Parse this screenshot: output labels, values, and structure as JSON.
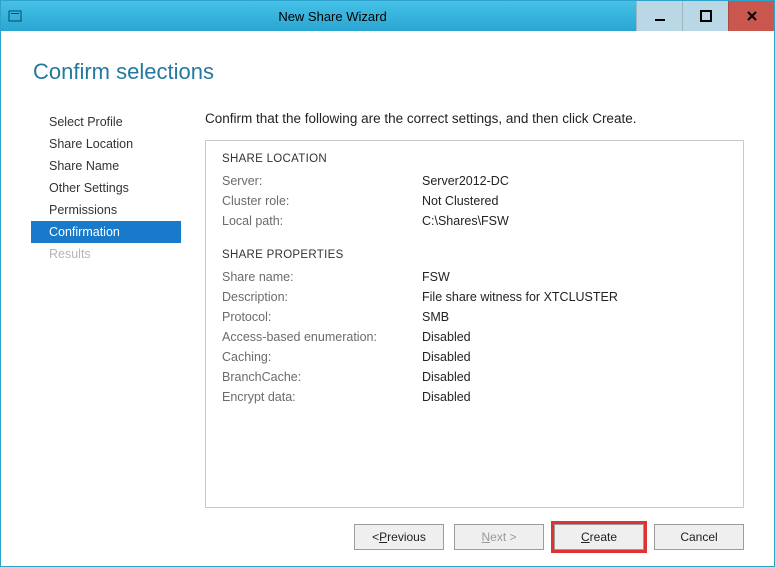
{
  "window": {
    "title": "New Share Wizard"
  },
  "heading": "Confirm selections",
  "sidebar": {
    "items": [
      {
        "label": "Select Profile"
      },
      {
        "label": "Share Location"
      },
      {
        "label": "Share Name"
      },
      {
        "label": "Other Settings"
      },
      {
        "label": "Permissions"
      },
      {
        "label": "Confirmation"
      },
      {
        "label": "Results"
      }
    ]
  },
  "main": {
    "instruction": "Confirm that the following are the correct settings, and then click Create.",
    "sections": {
      "location": {
        "title": "SHARE LOCATION",
        "server_lbl": "Server:",
        "server_val": "Server2012-DC",
        "cluster_lbl": "Cluster role:",
        "cluster_val": "Not Clustered",
        "path_lbl": "Local path:",
        "path_val": "C:\\Shares\\FSW"
      },
      "props": {
        "title": "SHARE PROPERTIES",
        "name_lbl": "Share name:",
        "name_val": "FSW",
        "desc_lbl": "Description:",
        "desc_val": "File share witness for XTCLUSTER",
        "proto_lbl": "Protocol:",
        "proto_val": "SMB",
        "abe_lbl": "Access-based enumeration:",
        "abe_val": "Disabled",
        "cache_lbl": "Caching:",
        "cache_val": "Disabled",
        "bc_lbl": "BranchCache:",
        "bc_val": "Disabled",
        "enc_lbl": "Encrypt data:",
        "enc_val": "Disabled"
      }
    }
  },
  "footer": {
    "previous_pre": "< ",
    "previous_u": "P",
    "previous_post": "revious",
    "next_u": "N",
    "next_post": "ext >",
    "create_u": "C",
    "create_post": "reate",
    "cancel": "Cancel"
  }
}
